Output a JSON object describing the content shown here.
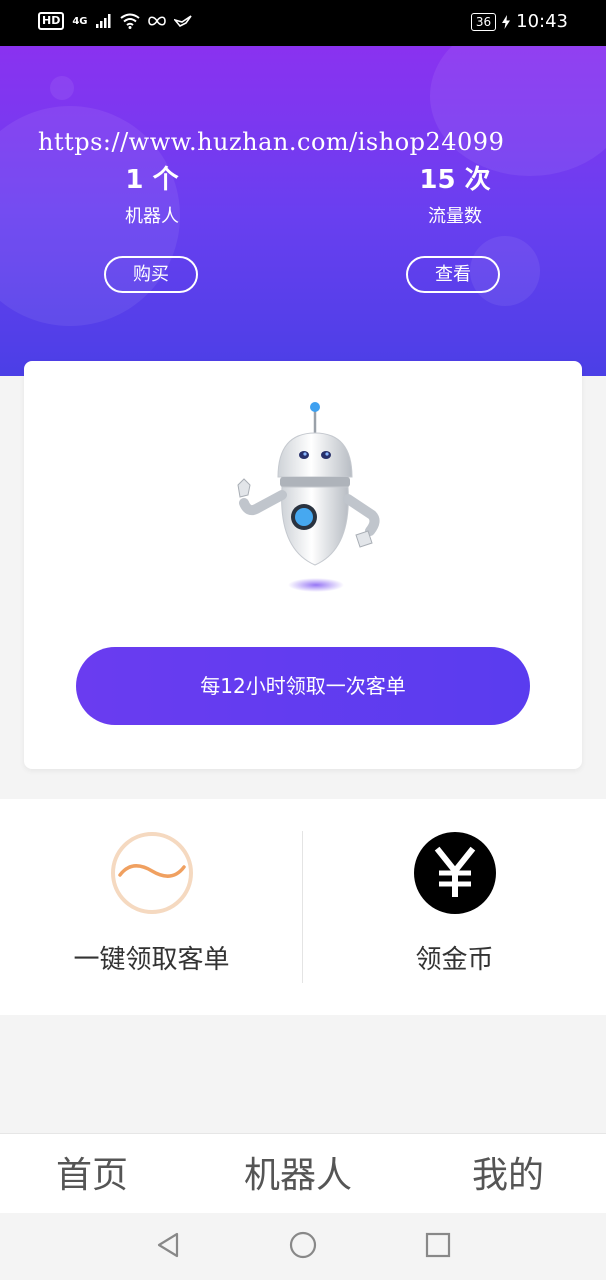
{
  "status_bar": {
    "hd": "HD",
    "network": "4G",
    "battery": "36",
    "time": "10:43"
  },
  "header": {
    "watermark": "https://www.huzhan.com/ishop24099",
    "robots": {
      "value": "1 个",
      "label": "机器人"
    },
    "traffic": {
      "value": "15 次",
      "label": "流量数"
    },
    "buy_label": "购买",
    "view_label": "查看"
  },
  "card": {
    "claim_label": "每12小时领取一次客单"
  },
  "features": {
    "one_click_label": "一键领取客单",
    "coins_label": "领金币"
  },
  "tabbar": {
    "home": "首页",
    "robot": "机器人",
    "mine": "我的"
  },
  "colors": {
    "header_top": "#8a32f0",
    "header_bottom": "#4b3fe6",
    "accent": "#5a3cef",
    "wave_icon": "#f0a060",
    "coin_icon": "#000000"
  },
  "icons": [
    "wave-icon",
    "yen-coin-icon",
    "robot-illustration",
    "back-icon",
    "home-circle-icon",
    "recents-icon"
  ]
}
